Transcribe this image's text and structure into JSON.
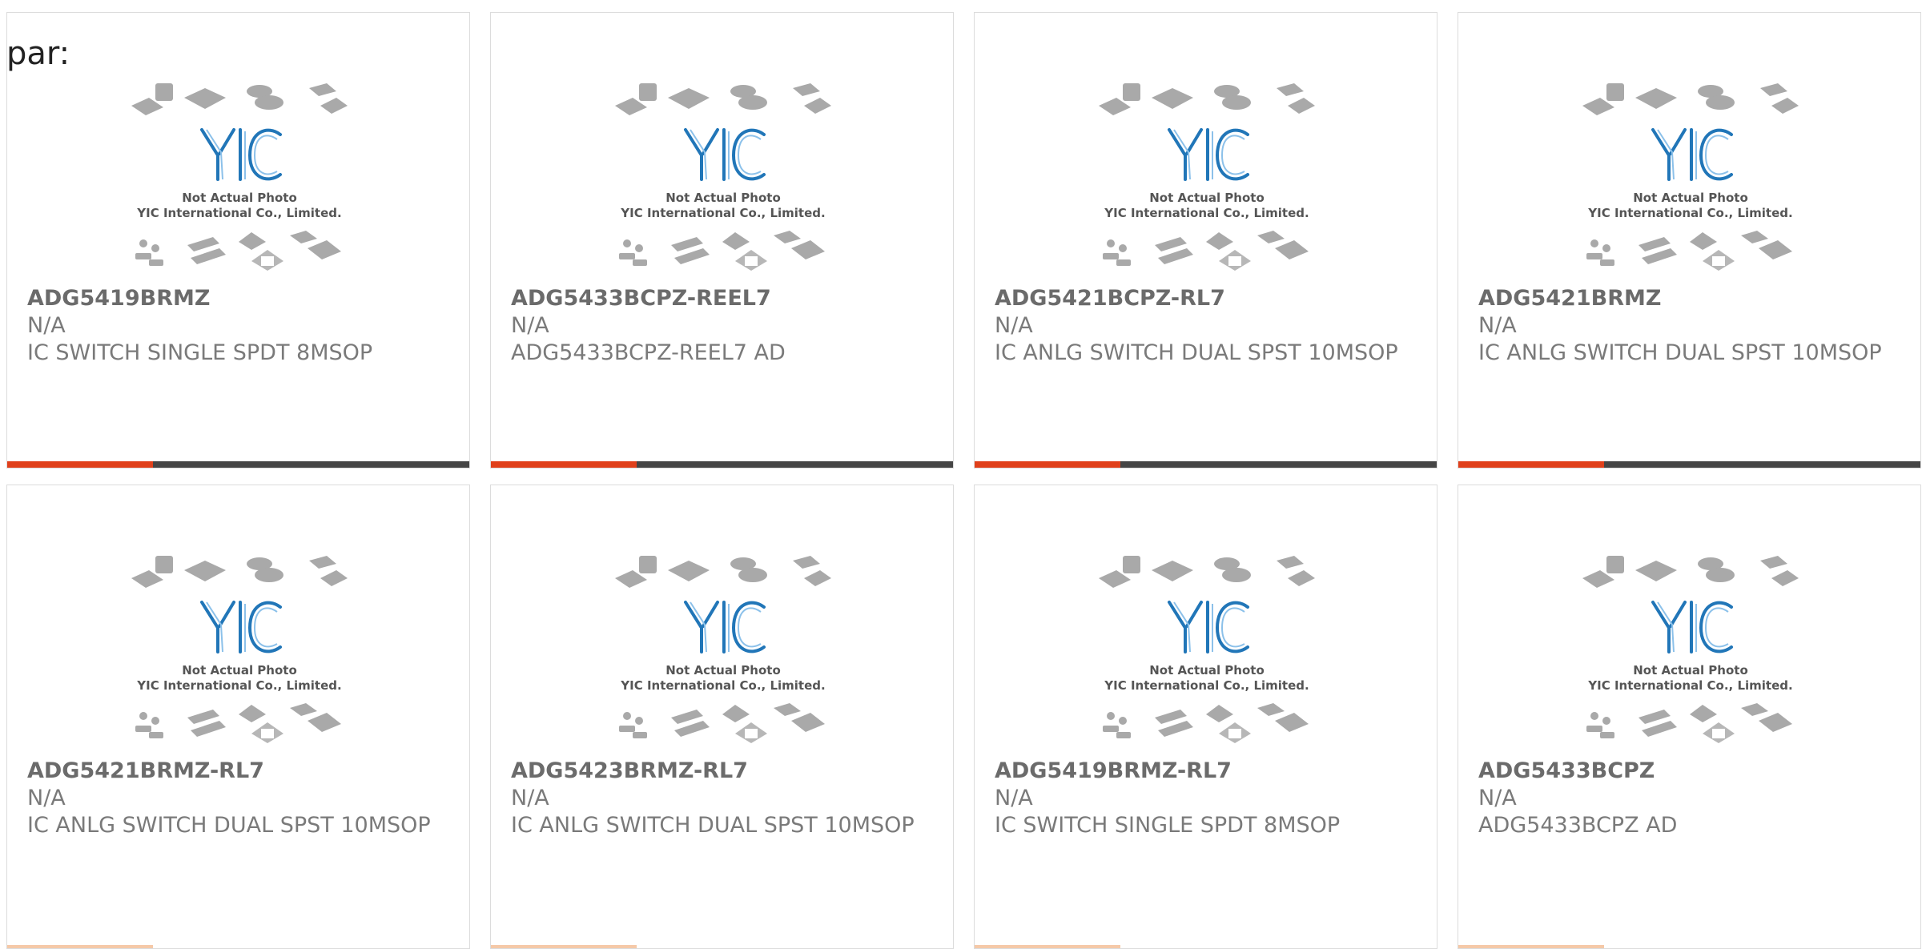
{
  "page": {
    "label": "par:"
  },
  "thumbnail": {
    "logo_text": "YIC",
    "caption_line1": "Not Actual Photo",
    "caption_line2": "YIC International Co., Limited."
  },
  "accent_color": "#e0401b",
  "products": [
    {
      "part_number": "ADG5419BRMZ",
      "manufacturer": "N/A",
      "description": "IC SWITCH SINGLE SPDT 8MSOP"
    },
    {
      "part_number": "ADG5433BCPZ-REEL7",
      "manufacturer": "N/A",
      "description": "ADG5433BCPZ-REEL7 AD"
    },
    {
      "part_number": "ADG5421BCPZ-RL7",
      "manufacturer": "N/A",
      "description": "IC ANLG SWITCH DUAL SPST 10MSOP"
    },
    {
      "part_number": "ADG5421BRMZ",
      "manufacturer": "N/A",
      "description": "IC ANLG SWITCH DUAL SPST 10MSOP"
    },
    {
      "part_number": "ADG5421BRMZ-RL7",
      "manufacturer": "N/A",
      "description": "IC ANLG SWITCH DUAL SPST 10MSOP"
    },
    {
      "part_number": "ADG5423BRMZ-RL7",
      "manufacturer": "N/A",
      "description": "IC ANLG SWITCH DUAL SPST 10MSOP"
    },
    {
      "part_number": "ADG5419BRMZ-RL7",
      "manufacturer": "N/A",
      "description": "IC SWITCH SINGLE SPDT 8MSOP"
    },
    {
      "part_number": "ADG5433BCPZ",
      "manufacturer": "N/A",
      "description": "ADG5433BCPZ AD"
    }
  ]
}
